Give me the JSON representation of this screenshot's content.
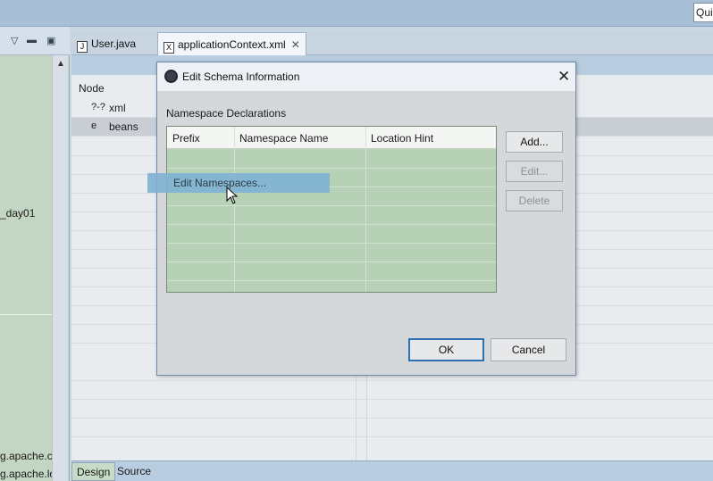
{
  "toolbar": {
    "quick_access_text": "Quick Access"
  },
  "left_panel": {
    "lines": [
      "_day01",
      "g.apache.c",
      "g.apache.lo"
    ]
  },
  "editor": {
    "tabs": [
      {
        "label": "User.java",
        "icon": "J"
      },
      {
        "label": "applicationContext.xml",
        "icon": "X"
      }
    ],
    "node_header": "Node",
    "nodes": [
      {
        "icon": "?-?",
        "label": "xml"
      },
      {
        "icon": "e",
        "label": "beans"
      }
    ],
    "bottom_tabs": [
      "Design",
      "Source"
    ]
  },
  "dialog": {
    "title": "Edit Schema Information",
    "section_label": "Namespace Declarations",
    "columns": [
      "Prefix",
      "Namespace Name",
      "Location Hint"
    ],
    "buttons": {
      "add": "Add...",
      "edit": "Edit...",
      "delete": "Delete",
      "ok": "OK",
      "cancel": "Cancel"
    }
  },
  "popup": {
    "item": "Edit Namespaces..."
  },
  "colors": {
    "accent": "#2e6fb5",
    "table_bg": "#b6d1b6",
    "highlight": "#7fb2d4"
  }
}
